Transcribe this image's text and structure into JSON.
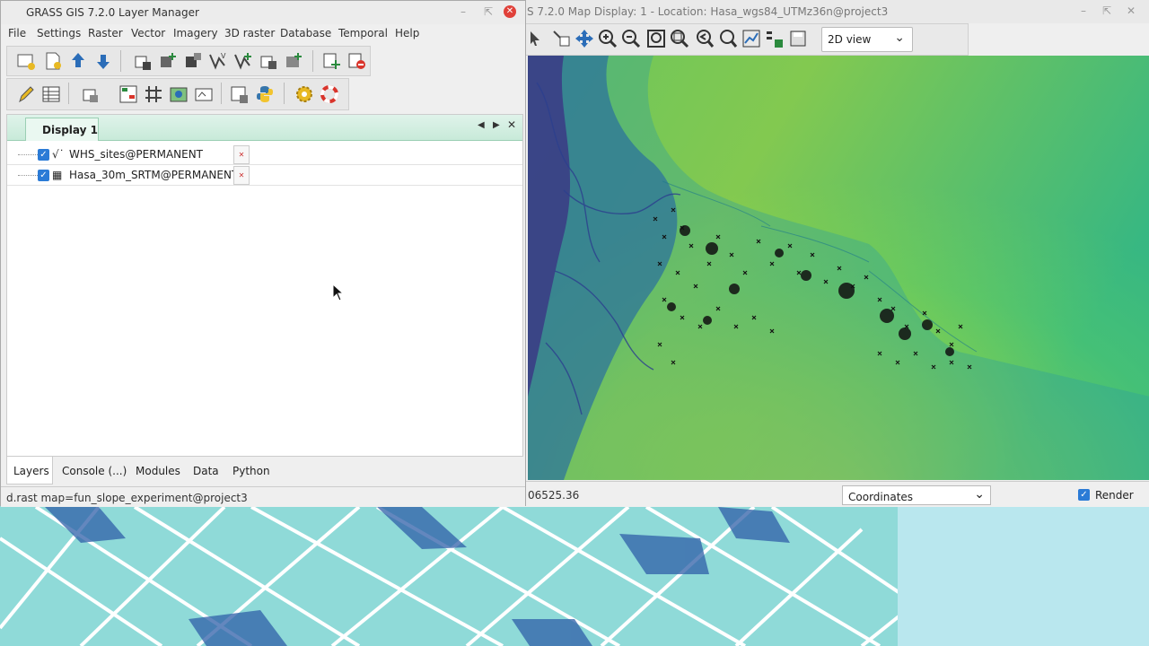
{
  "layer_manager": {
    "title": "GRASS GIS 7.2.0 Layer Manager",
    "menu": [
      "File",
      "Settings",
      "Raster",
      "Vector",
      "Imagery",
      "3D raster",
      "Database",
      "Temporal",
      "Help"
    ],
    "display_tab": "Display 1",
    "layers": [
      {
        "name": "WHS_sites@PERMANENT",
        "checked": true,
        "icon": "vector-points-icon"
      },
      {
        "name": "Hasa_30m_SRTM@PERMANENT",
        "checked": true,
        "icon": "raster-icon"
      }
    ],
    "bottom_tabs": [
      "Layers",
      "Console (...)",
      "Modules",
      "Data",
      "Python"
    ],
    "active_bottom_tab": "Layers",
    "command": "d.rast map=fun_slope_experiment@project3"
  },
  "map_display": {
    "title": "S 7.2.0 Map Display: 1 - Location: Hasa_wgs84_UTMz36n@project3",
    "view_mode": "2D view",
    "coord_readout": "06525.36",
    "status_mode": "Coordinates",
    "render_label": "Render",
    "render_checked": true
  },
  "colors": {
    "close_button": "#e0413a",
    "accent_blue": "#2b7bd6",
    "notebook_tab_green": "#c8ead9"
  },
  "window_controls": [
    "minimize-icon",
    "maximize-icon",
    "close-icon"
  ]
}
